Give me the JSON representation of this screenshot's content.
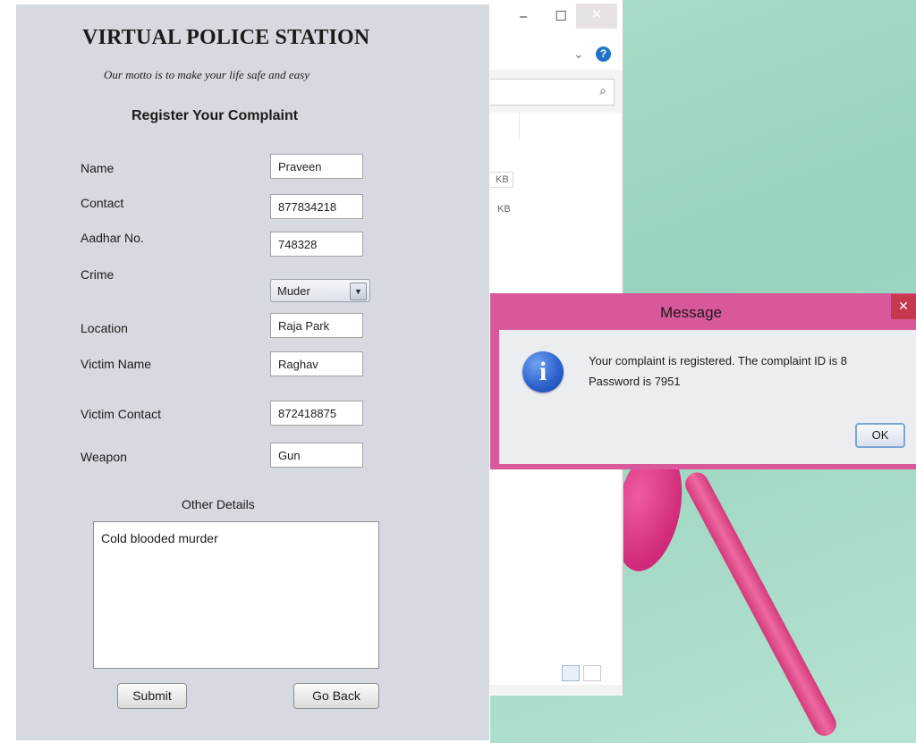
{
  "app": {
    "title": "VIRTUAL POLICE STATION",
    "motto": "Our motto is to make your life safe and easy",
    "form_heading": "Register Your Complaint"
  },
  "form": {
    "name": {
      "label": "Name",
      "value": "Praveen"
    },
    "contact": {
      "label": "Contact",
      "value": "877834218"
    },
    "aadhar": {
      "label": "Aadhar No.",
      "value": "748328"
    },
    "crime": {
      "label": "Crime",
      "value": "Muder"
    },
    "location": {
      "label": "Location",
      "value": "Raja Park"
    },
    "victim_name": {
      "label": "Victim Name",
      "value": "Raghav"
    },
    "victim_contact": {
      "label": "Victim Contact",
      "value": "872418875"
    },
    "weapon": {
      "label": "Weapon",
      "value": "Gun"
    },
    "other_details": {
      "label": "Other Details",
      "value": "Cold blooded murder"
    },
    "submit_label": "Submit",
    "back_label": "Go Back"
  },
  "explorer": {
    "min_glyph": "–",
    "max_glyph": "☐",
    "close_glyph": "✕",
    "chevron_glyph": "⌄",
    "help_glyph": "?",
    "search_glyph": "⌕",
    "sizes": [
      "KB",
      "KB"
    ]
  },
  "dialog": {
    "title": "Message",
    "close_glyph": "✕",
    "icon_glyph": "i",
    "line1": "Your complaint is registered. The complaint ID is 8",
    "line2": "Password is 7951",
    "ok_label": "OK"
  },
  "colors": {
    "dialog_frame": "#d9589a",
    "app_background": "#d6d9e0",
    "wallpaper_green": "#a9dcc8",
    "flower_pink": "#d3307d",
    "info_blue": "#2b5fc9"
  },
  "icons": [
    "minimize-icon",
    "maximize-icon",
    "close-icon",
    "chevron-down-icon",
    "help-icon",
    "search-icon",
    "details-view-icon",
    "thumbnail-view-icon",
    "dropdown-arrow-icon",
    "info-icon"
  ]
}
